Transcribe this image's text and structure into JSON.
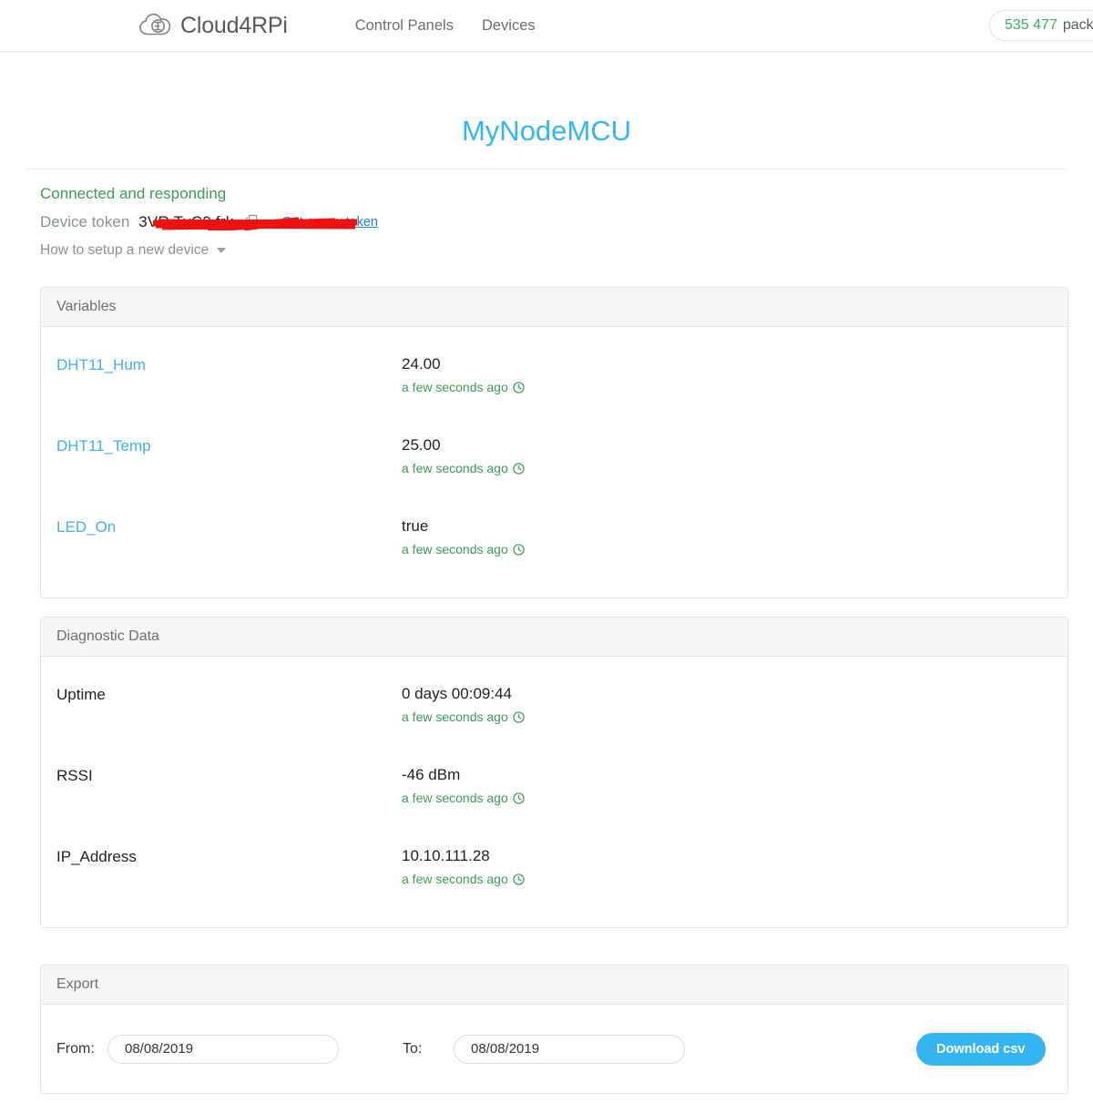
{
  "header": {
    "brand_name": "Cloud4RPi",
    "logo_icon": "cloud-logo-icon",
    "nav": [
      {
        "label": "Control Panels",
        "name": "nav-control-panels"
      },
      {
        "label": "Devices",
        "name": "nav-devices"
      }
    ],
    "packets": {
      "count": "535 477",
      "label": "packets"
    }
  },
  "page": {
    "title": "MyNodeMCU",
    "status": "Connected and responding",
    "token_label": "Device token",
    "token_value": "3VR TvC9                  frk",
    "copy_icon": "copy-icon",
    "new_token_link": "Get a new token",
    "setup_link": "How to setup a new device",
    "caret_icon": "chevron-down-icon"
  },
  "variables": {
    "header": "Variables",
    "rows": [
      {
        "name": "DHT11_Hum",
        "value": "24.00",
        "time": "a few seconds ago"
      },
      {
        "name": "DHT11_Temp",
        "value": "25.00",
        "time": "a few seconds ago"
      },
      {
        "name": "LED_On",
        "value": "true",
        "time": "a few seconds ago"
      }
    ]
  },
  "diagnostics": {
    "header": "Diagnostic Data",
    "rows": [
      {
        "name": "Uptime",
        "value": "0 days 00:09:44",
        "time": "a few seconds ago"
      },
      {
        "name": "RSSI",
        "value": "-46 dBm",
        "time": "a few seconds ago"
      },
      {
        "name": "IP_Address",
        "value": "10.10.111.28",
        "time": "a few seconds ago"
      }
    ]
  },
  "export": {
    "header": "Export",
    "from_label": "From:",
    "from_value": "08/08/2019",
    "to_label": "To:",
    "to_value": "08/08/2019",
    "download_label": "Download csv"
  },
  "colors": {
    "accent": "#35b5ef",
    "link": "#3fb0e8",
    "success": "#3d9b54",
    "muted": "#8a9097",
    "redaction": "#ee1111"
  }
}
